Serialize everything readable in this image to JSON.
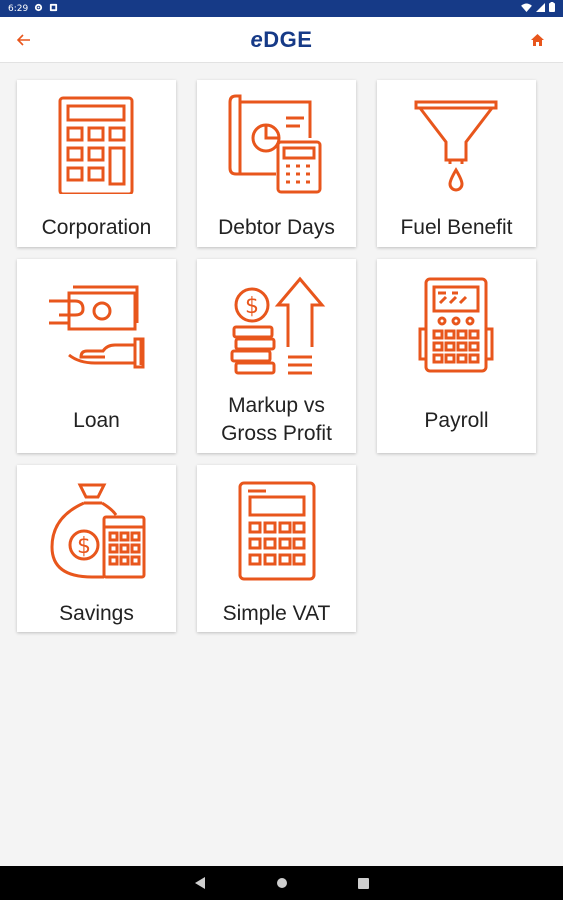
{
  "status_bar": {
    "time": "6:29"
  },
  "app_bar": {
    "logo_text": "DGE",
    "logo_prefix": "e"
  },
  "tiles": [
    {
      "label": "Corporation",
      "icon": "calculator-icon"
    },
    {
      "label": "Debtor Days",
      "icon": "blueprint-calculator-icon"
    },
    {
      "label": "Fuel Benefit",
      "icon": "funnel-drop-icon"
    },
    {
      "label": "Loan",
      "icon": "hand-money-icon"
    },
    {
      "label_line1": "Markup vs",
      "label_line2": "Gross Profit",
      "icon": "coins-arrow-up-icon"
    },
    {
      "label": "Payroll",
      "icon": "financial-calculator-icon"
    },
    {
      "label": "Savings",
      "icon": "money-bag-calculator-icon"
    },
    {
      "label": "Simple VAT",
      "icon": "calculator-icon"
    }
  ],
  "colors": {
    "accent": "#e8561c",
    "brand": "#163a87",
    "status_bar": "#163a87"
  }
}
